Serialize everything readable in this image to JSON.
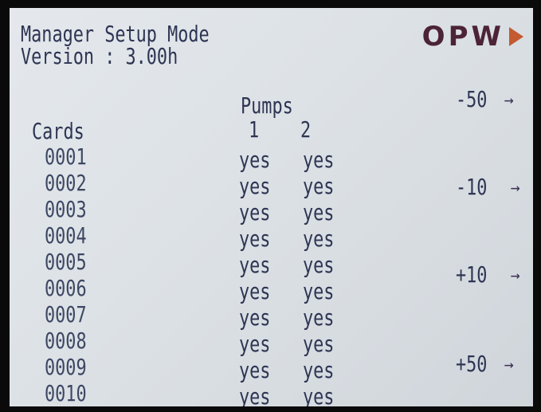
{
  "header": {
    "title": "Manager Setup Mode",
    "version": "Version : 3.00h",
    "logo": "OPW"
  },
  "table": {
    "pumps_label": "Pumps",
    "pump_columns": [
      "1",
      "2"
    ],
    "cards_label": "Cards",
    "rows": [
      {
        "card": "0001",
        "pump1": "yes",
        "pump2": "yes"
      },
      {
        "card": "0002",
        "pump1": "yes",
        "pump2": "yes"
      },
      {
        "card": "0003",
        "pump1": "yes",
        "pump2": "yes"
      },
      {
        "card": "0004",
        "pump1": "yes",
        "pump2": "yes"
      },
      {
        "card": "0005",
        "pump1": "yes",
        "pump2": "yes"
      },
      {
        "card": "0006",
        "pump1": "yes",
        "pump2": "yes"
      },
      {
        "card": "0007",
        "pump1": "yes",
        "pump2": "yes"
      },
      {
        "card": "0008",
        "pump1": "yes",
        "pump2": "yes"
      },
      {
        "card": "0009",
        "pump1": "yes",
        "pump2": "yes"
      },
      {
        "card": "0010",
        "pump1": "yes",
        "pump2": "yes"
      }
    ]
  },
  "softkeys": [
    {
      "label": "-50",
      "arrow": "→"
    },
    {
      "label": "-10",
      "arrow": "→"
    },
    {
      "label": "+10",
      "arrow": "→"
    },
    {
      "label": "+50",
      "arrow": "→"
    }
  ],
  "colors": {
    "screen_background": "#dde2e6",
    "text": "#2e3553",
    "logo": "#4c2338",
    "logo_arrow": "#c35a32"
  }
}
